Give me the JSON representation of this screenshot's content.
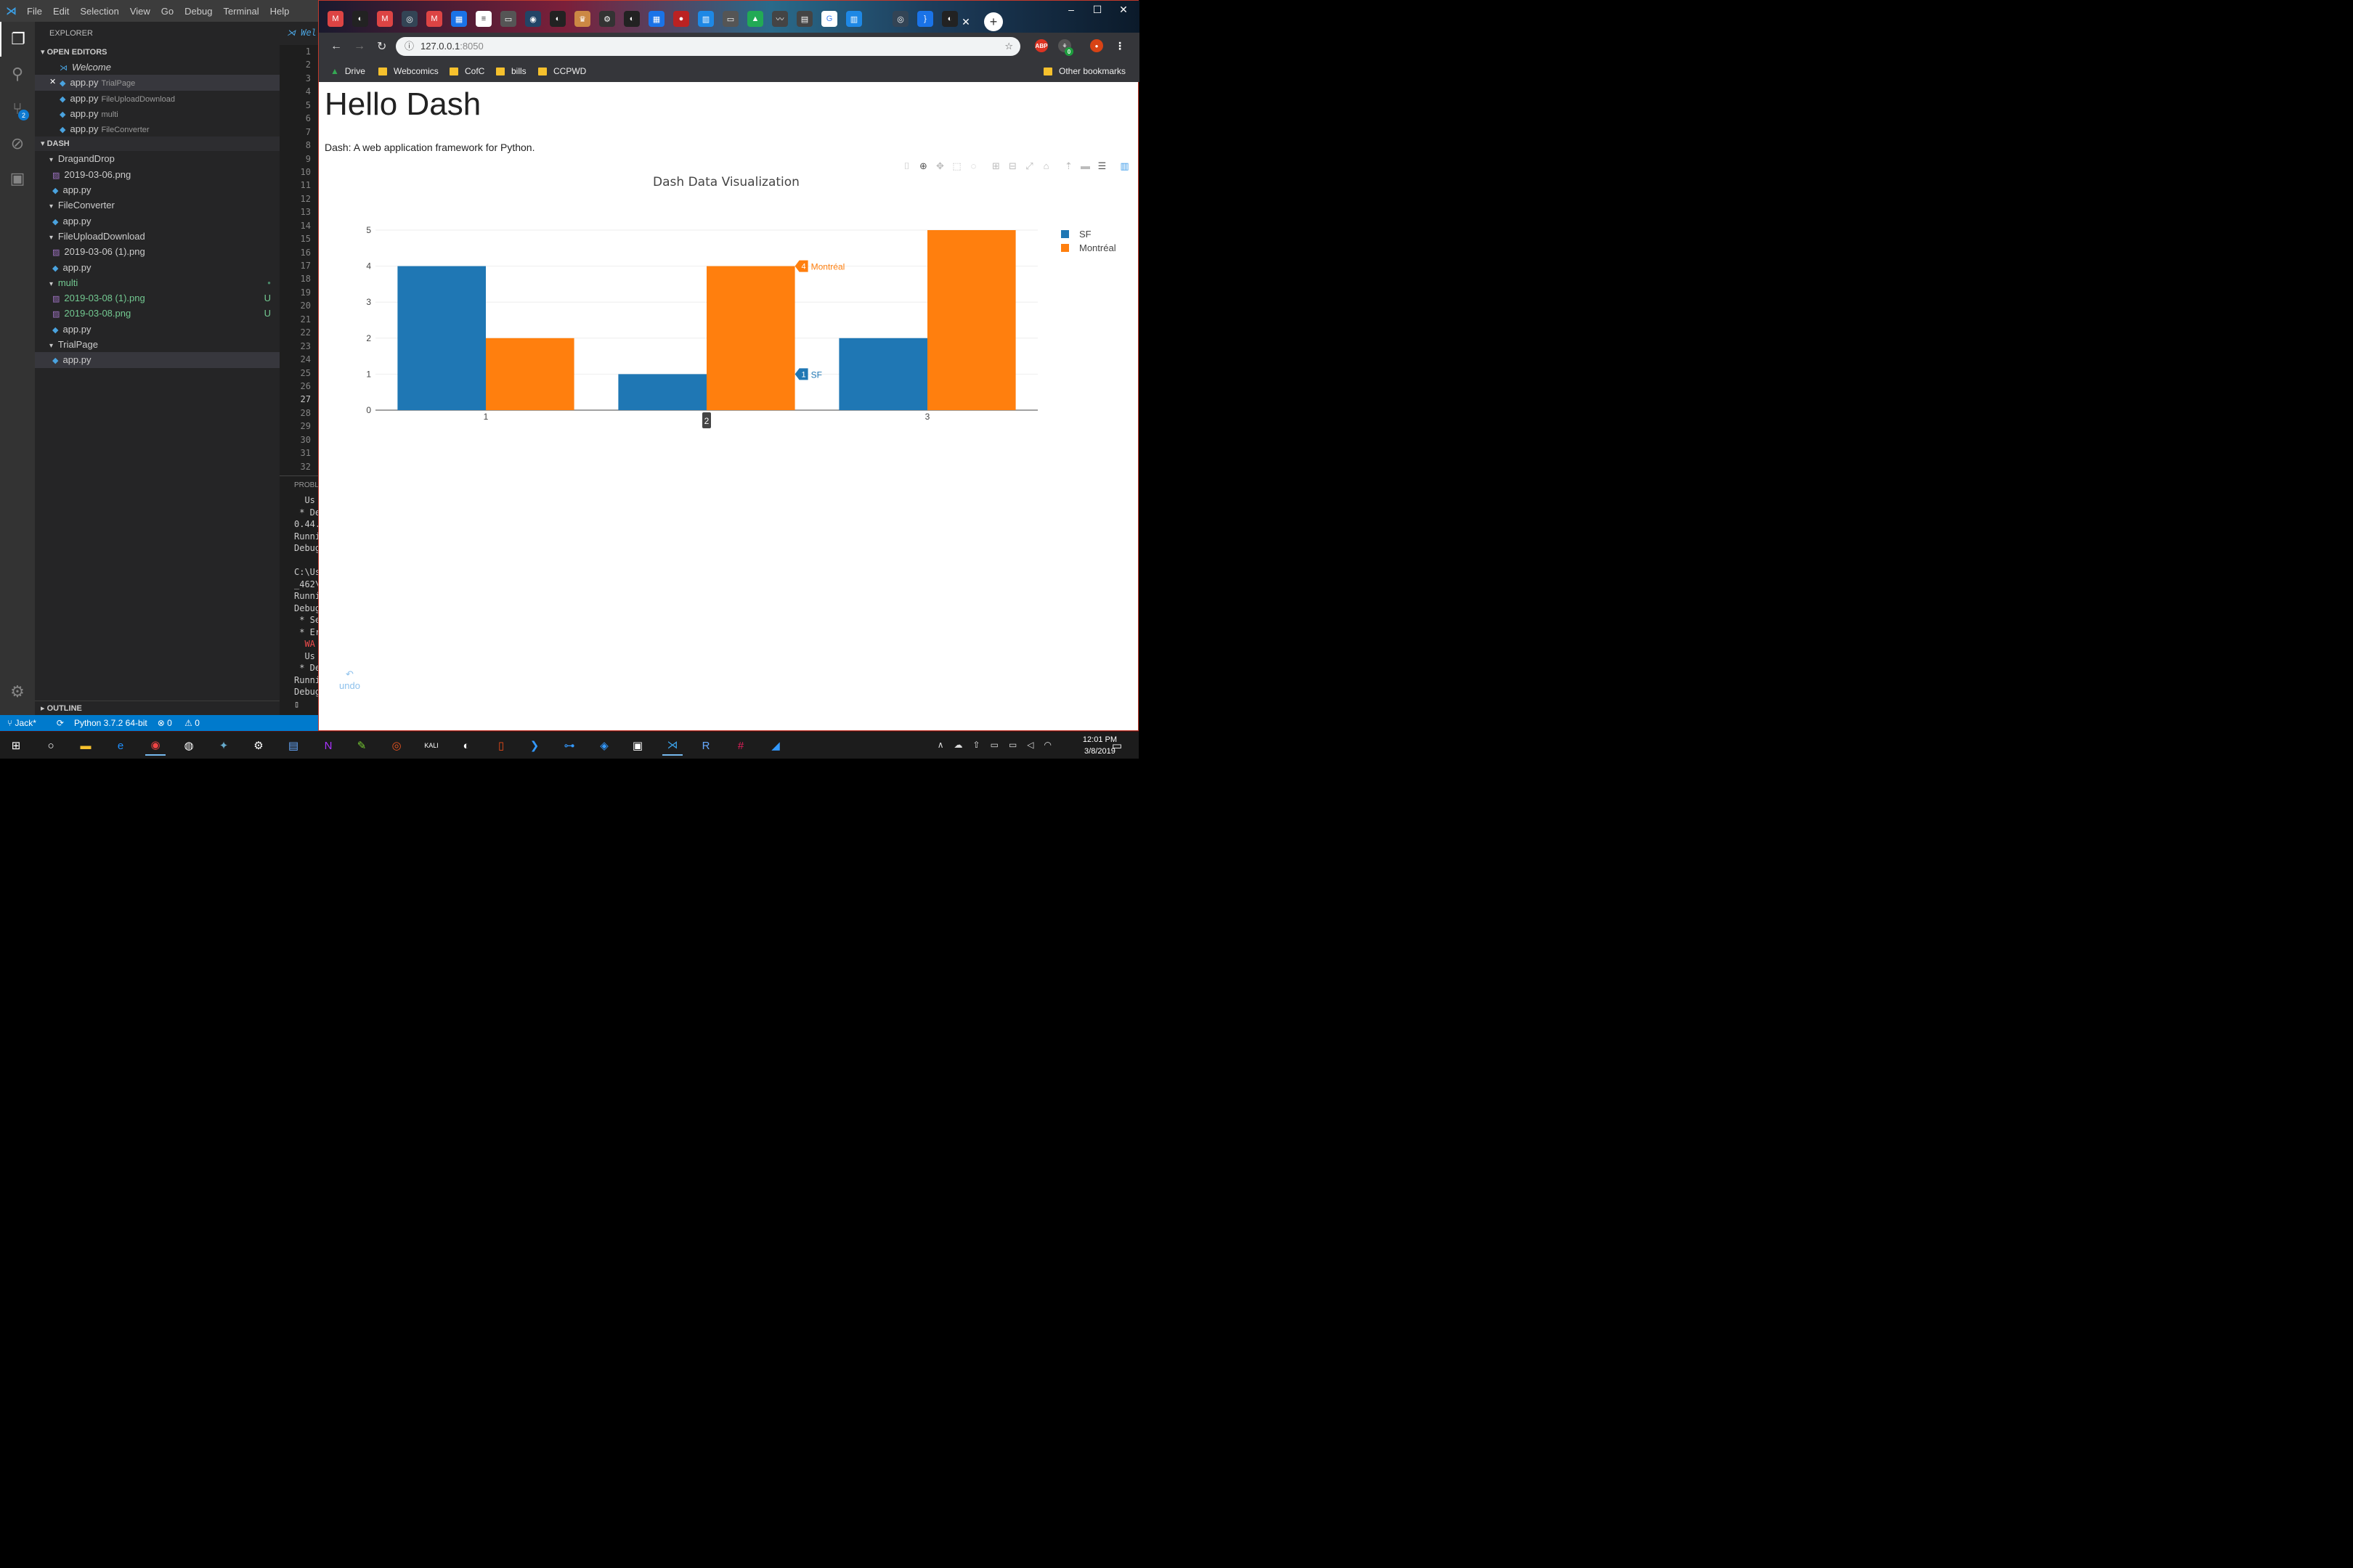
{
  "vscode": {
    "menu": [
      "File",
      "Edit",
      "Selection",
      "View",
      "Go",
      "Debug",
      "Terminal",
      "Help"
    ],
    "activity_badge": "2",
    "explorer_title": "EXPLORER",
    "open_editors_title": "OPEN EDITORS",
    "open_editors": [
      {
        "name": "Welcome",
        "sub": "",
        "icon": "vscode-icon"
      },
      {
        "name": "app.py",
        "sub": "TrialPage",
        "icon": "python-icon",
        "close": true
      },
      {
        "name": "app.py",
        "sub": "FileUploadDownload",
        "icon": "python-icon"
      },
      {
        "name": "app.py",
        "sub": "multi",
        "icon": "python-icon"
      },
      {
        "name": "app.py",
        "sub": "FileConverter",
        "icon": "python-icon"
      }
    ],
    "project_title": "DASH",
    "tree": [
      {
        "label": "DragandDrop",
        "type": "folder",
        "indent": 1
      },
      {
        "label": "2019-03-06.png",
        "type": "image",
        "indent": 2
      },
      {
        "label": "app.py",
        "type": "python",
        "indent": 2
      },
      {
        "label": "FileConverter",
        "type": "folder",
        "indent": 1
      },
      {
        "label": "app.py",
        "type": "python",
        "indent": 2
      },
      {
        "label": "FileUploadDownload",
        "type": "folder",
        "indent": 1
      },
      {
        "label": "2019-03-06 (1).png",
        "type": "image",
        "indent": 2
      },
      {
        "label": "app.py",
        "type": "python",
        "indent": 2
      },
      {
        "label": "multi",
        "type": "folder",
        "indent": 1,
        "status": "modified"
      },
      {
        "label": "2019-03-08 (1).png",
        "type": "image",
        "indent": 2,
        "status": "U"
      },
      {
        "label": "2019-03-08.png",
        "type": "image",
        "indent": 2,
        "status": "U"
      },
      {
        "label": "app.py",
        "type": "python",
        "indent": 2
      },
      {
        "label": "TrialPage",
        "type": "folder",
        "indent": 1
      },
      {
        "label": "app.py",
        "type": "python",
        "indent": 2,
        "selected": true
      }
    ],
    "editor_tab_stub": "Wel",
    "line_numbers": [
      "1",
      "2",
      "3",
      "4",
      "5",
      "6",
      "7",
      "8",
      "9",
      "10",
      "11",
      "12",
      "13",
      "14",
      "15",
      "16",
      "17",
      "18",
      "19",
      "20",
      "21",
      "22",
      "23",
      "24",
      "25",
      "26",
      "27",
      "28",
      "29",
      "30",
      "31",
      "32"
    ],
    "panel_header_stub": "PROBL",
    "terminal_lines": [
      "  Us",
      " * De",
      "0.44.",
      "Runni",
      "Debug",
      "",
      "C:\\Us",
      "_462\\",
      "Runni",
      "Debug",
      " * Se",
      " * Er",
      "  WA",
      "  Us",
      " * De",
      "Runni",
      "Debug",
      "▯"
    ],
    "outline_title": "OUTLINE",
    "status": {
      "branch": "Jack*",
      "python": "Python 3.7.2 64-bit",
      "errors": "0",
      "warnings": "0"
    }
  },
  "chrome": {
    "url_host": "127.0.0.1",
    "url_port": ":8050",
    "bookmarks": [
      "Drive",
      "Webcomics",
      "CofC",
      "bills",
      "CCPWD"
    ],
    "other_bookmarks": "Other bookmarks",
    "ext_abp": "ABP",
    "ext_badge": "0"
  },
  "page": {
    "heading": "Hello Dash",
    "description": "Dash: A web application framework for Python.",
    "undo_label": "undo"
  },
  "chart_data": {
    "type": "bar",
    "title": "Dash Data Visualization",
    "x": [
      1,
      2,
      3
    ],
    "tick_labels": [
      "1",
      "2",
      "3"
    ],
    "series": [
      {
        "name": "SF",
        "values": [
          4,
          1,
          2
        ],
        "color": "#1f77b4"
      },
      {
        "name": "Montréal",
        "values": [
          2,
          4,
          5
        ],
        "color": "#ff7f0e"
      }
    ],
    "ylim": [
      0,
      5
    ],
    "y_ticks": [
      0,
      1,
      2,
      3,
      4,
      5
    ],
    "grid": true,
    "legend_position": "top-right",
    "hover": {
      "x_label": "2",
      "labels": [
        {
          "series": "Montréal",
          "value": "4"
        },
        {
          "series": "SF",
          "value": "1"
        }
      ]
    }
  },
  "taskbar": {
    "time": "12:01 PM",
    "date": "3/8/2019"
  }
}
